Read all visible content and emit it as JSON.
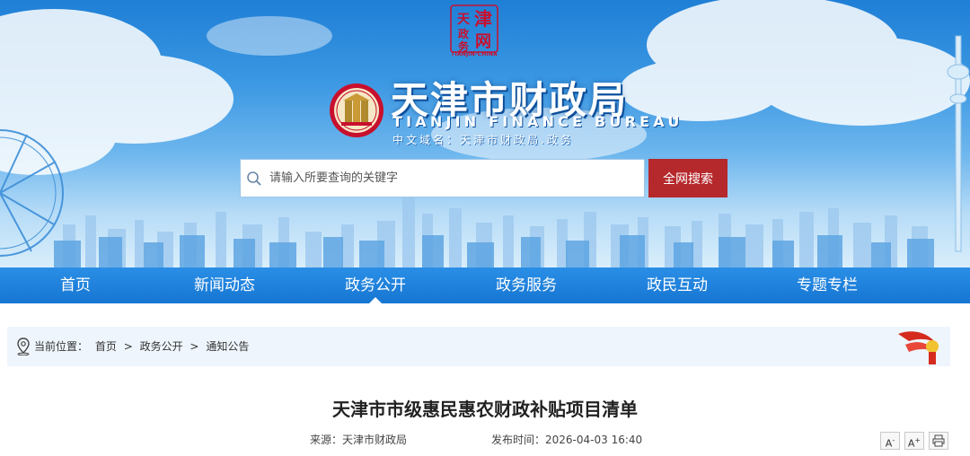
{
  "header": {
    "seal_chars": [
      "津",
      "天",
      "政",
      "务",
      "网"
    ],
    "seal_caption": "TIANJIN·CHINA",
    "site_title": "天津市财政局",
    "site_title_en": "TIANJIN FINANCE BUREAU",
    "domain_line": "中文域名：天津市财政局.政务",
    "emblem_icon": "finance-bureau-emblem",
    "brand_red": "#c8102e"
  },
  "search": {
    "placeholder": "请输入所要查询的关键字",
    "button_label": "全网搜索",
    "button_color": "#b5282c"
  },
  "nav": {
    "items": [
      {
        "label": "首页"
      },
      {
        "label": "新闻动态"
      },
      {
        "label": "政务公开",
        "active": true
      },
      {
        "label": "政务服务"
      },
      {
        "label": "政民互动"
      },
      {
        "label": "专题专栏"
      }
    ],
    "bar_color": "#1676d2"
  },
  "breadcrumb": {
    "prefix": "当前位置：",
    "items": [
      "首页",
      "政务公开",
      "通知公告"
    ],
    "separator": ">"
  },
  "article": {
    "title": "天津市市级惠民惠农财政补贴项目清单",
    "source_label": "来源：",
    "source_value": "天津市财政局",
    "date_label": "发布时间：",
    "date_value": "2026-04-03 16:40",
    "tools": {
      "font_decrease": "A",
      "font_decrease_sup": "-",
      "font_increase": "A",
      "font_increase_sup": "+",
      "print_icon": "printer-icon"
    }
  }
}
